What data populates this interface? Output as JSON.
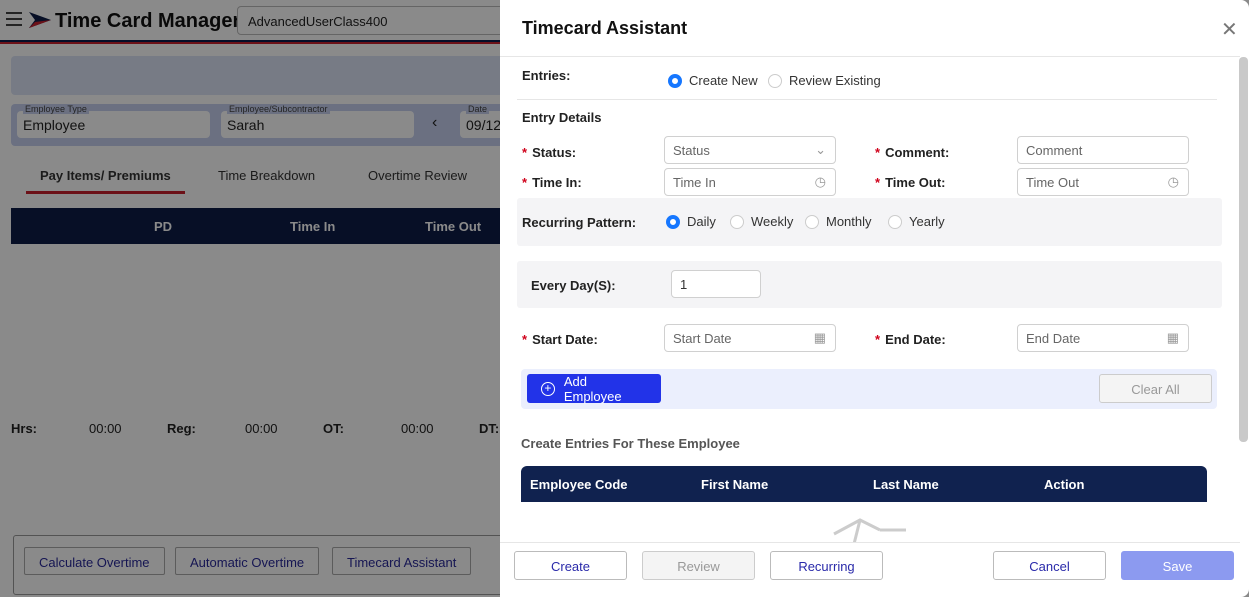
{
  "app": {
    "title": "Time Card Manager",
    "user_class": "AdvancedUserClass400",
    "filters": {
      "employee_type_label": "Employee Type",
      "employee_type_value": "Employee",
      "employee_label": "Employee/Subcontractor",
      "employee_value": "Sarah",
      "date_label": "Date",
      "date_value": "09/12"
    },
    "tabs": [
      "Pay Items/ Premiums",
      "Time Breakdown",
      "Overtime Review"
    ],
    "table_headers": [
      "PD",
      "Time In",
      "Time Out"
    ],
    "totals": [
      {
        "label": "Hrs:",
        "value": "00:00"
      },
      {
        "label": "Reg:",
        "value": "00:00"
      },
      {
        "label": "OT:",
        "value": "00:00"
      },
      {
        "label": "DT:",
        "value": ""
      }
    ],
    "actions": [
      "Calculate Overtime",
      "Automatic Overtime",
      "Timecard Assistant"
    ]
  },
  "drawer": {
    "title": "Timecard Assistant",
    "entries_label": "Entries:",
    "entries_options": [
      "Create New",
      "Review Existing"
    ],
    "entries_selected": "Create New",
    "entry_details": "Entry Details",
    "status_label": "Status:",
    "status_placeholder": "Status",
    "comment_label": "Comment:",
    "comment_placeholder": "Comment",
    "time_in_label": "Time In:",
    "time_in_placeholder": "Time In",
    "time_out_label": "Time Out:",
    "time_out_placeholder": "Time Out",
    "recurring_label": "Recurring Pattern:",
    "recurring_options": [
      "Daily",
      "Weekly",
      "Monthly",
      "Yearly"
    ],
    "recurring_selected": "Daily",
    "every_label": "Every Day(S):",
    "every_value": "1",
    "start_label": "Start Date:",
    "start_placeholder": "Start Date",
    "end_label": "End Date:",
    "end_placeholder": "End Date",
    "add_employee": "Add Employee",
    "clear_all": "Clear All",
    "list_title": "Create Entries For These Employee",
    "columns": [
      "Employee Code",
      "First Name",
      "Last Name",
      "Action"
    ],
    "footer": {
      "create": "Create",
      "review": "Review",
      "recurring": "Recurring",
      "cancel": "Cancel",
      "save": "Save"
    }
  },
  "colors": {
    "brand_navy": "#0d1c47",
    "brand_red": "#c8202e",
    "primary": "#2233e8",
    "save_disabled": "#8c9af0"
  }
}
